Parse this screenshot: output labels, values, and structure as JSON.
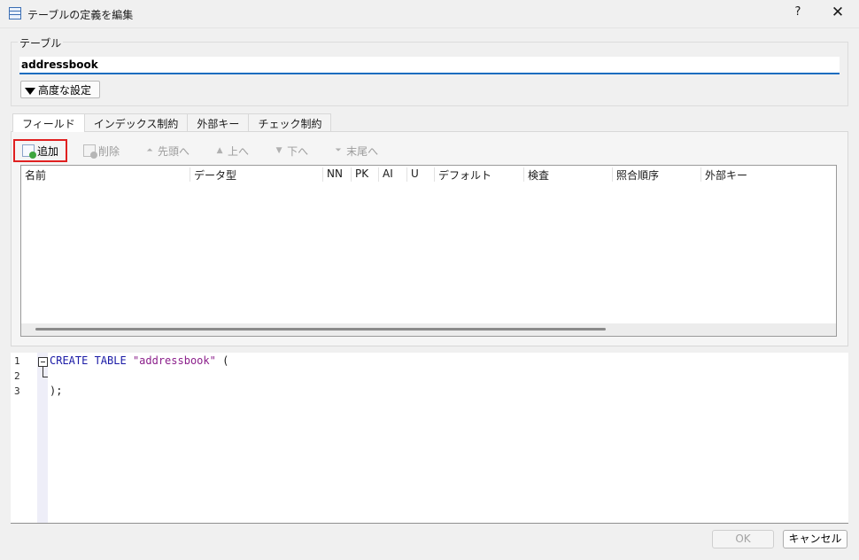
{
  "window": {
    "title": "テーブルの定義を編集",
    "help_label": "?",
    "close_label": "✕"
  },
  "table_group": {
    "label": "テーブル",
    "name_value": "addressbook",
    "advanced_label": "高度な設定"
  },
  "tabs": [
    {
      "label": "フィールド",
      "active": true
    },
    {
      "label": "インデックス制約",
      "active": false
    },
    {
      "label": "外部キー",
      "active": false
    },
    {
      "label": "チェック制約",
      "active": false
    }
  ],
  "toolbar": {
    "add_label": "追加",
    "delete_label": "削除",
    "first_label": "先頭へ",
    "up_label": "上へ",
    "down_label": "下へ",
    "last_label": "末尾へ"
  },
  "grid": {
    "columns": [
      "名前",
      "データ型",
      "NN",
      "PK",
      "AI",
      "U",
      "デフォルト",
      "検査",
      "照合順序",
      "外部キー"
    ]
  },
  "editor": {
    "line_numbers": [
      "1",
      "2",
      "3"
    ],
    "line1_keyword": "CREATE TABLE",
    "line1_string": "\"addressbook\"",
    "line1_rest": " (",
    "line3": ");"
  },
  "footer": {
    "ok_label": "OK",
    "cancel_label": "キャンセル"
  }
}
